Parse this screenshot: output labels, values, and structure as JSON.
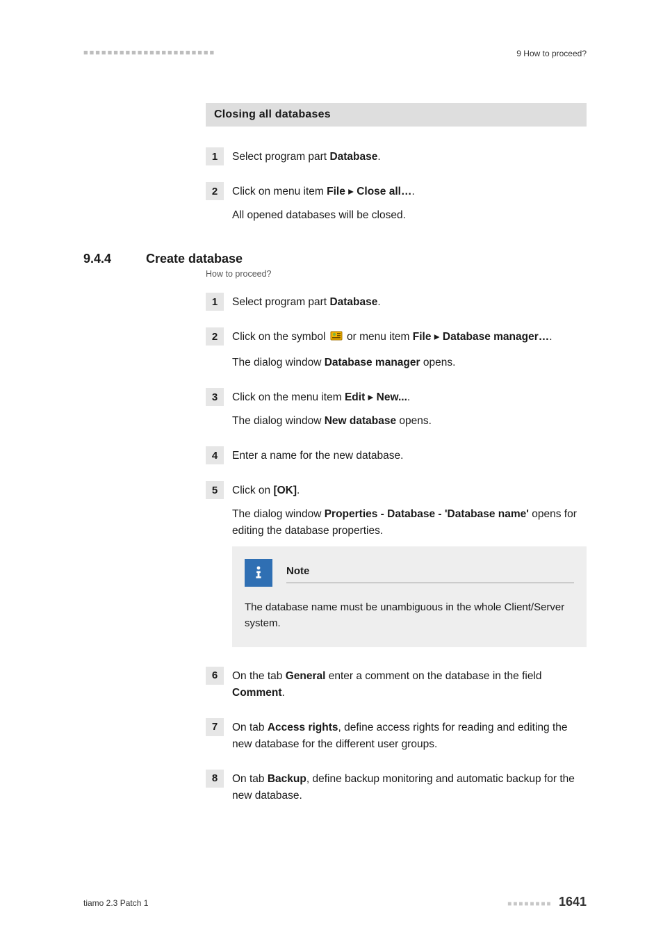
{
  "header": {
    "marks": "■■■■■■■■■■■■■■■■■■■■■■",
    "breadcrumb": "9 How to proceed?"
  },
  "sectionA": {
    "title": "Closing all databases",
    "steps": [
      {
        "num": "1",
        "line1_pre": "Select program part ",
        "line1_b": "Database",
        "line1_post": "."
      },
      {
        "num": "2",
        "line1_pre": "Click on menu item ",
        "line1_b1": "File",
        "line1_sep": " ▸ ",
        "line1_b2": "Close all…",
        "line1_post": ".",
        "line2": "All opened databases will be closed."
      }
    ]
  },
  "h2": {
    "num": "9.4.4",
    "title": "Create database",
    "sub": "How to proceed?"
  },
  "sectionB": {
    "steps": {
      "s1": {
        "num": "1",
        "pre": "Select program part ",
        "b": "Database",
        "post": "."
      },
      "s2": {
        "num": "2",
        "pre": "Click on the symbol ",
        "mid": " or menu item ",
        "b1": "File",
        "sep": " ▸ ",
        "b2": "Database manager…",
        "post": ".",
        "line2_pre": "The dialog window ",
        "line2_b": "Database manager",
        "line2_post": " opens."
      },
      "s3": {
        "num": "3",
        "pre": "Click on the menu item ",
        "b1": "Edit",
        "sep": " ▸ ",
        "b2": "New...",
        "post": ".",
        "line2_pre": "The dialog window ",
        "line2_b": "New database",
        "line2_post": " opens."
      },
      "s4": {
        "num": "4",
        "text": "Enter a name for the new database."
      },
      "s5": {
        "num": "5",
        "pre": "Click on ",
        "b": "[OK]",
        "post": ".",
        "line2_pre": "The dialog window ",
        "line2_b": "Properties - Database - 'Database name'",
        "line2_post": " opens for editing the database properties.",
        "note_title": "Note",
        "note_body": "The database name must be unambiguous in the whole Client/Server system."
      },
      "s6": {
        "num": "6",
        "pre": "On the tab ",
        "b1": "General",
        "mid": " enter a comment on the database in the field ",
        "b2": "Comment",
        "post": "."
      },
      "s7": {
        "num": "7",
        "pre": "On tab ",
        "b": "Access rights",
        "post": ", define access rights for reading and editing the new database for the different user groups."
      },
      "s8": {
        "num": "8",
        "pre": "On tab ",
        "b": "Backup",
        "post": ", define backup monitoring and automatic backup for the new database."
      }
    }
  },
  "footer": {
    "left": "tiamo 2.3 Patch 1",
    "marks": "■■■■■■■■",
    "page": "1641"
  }
}
